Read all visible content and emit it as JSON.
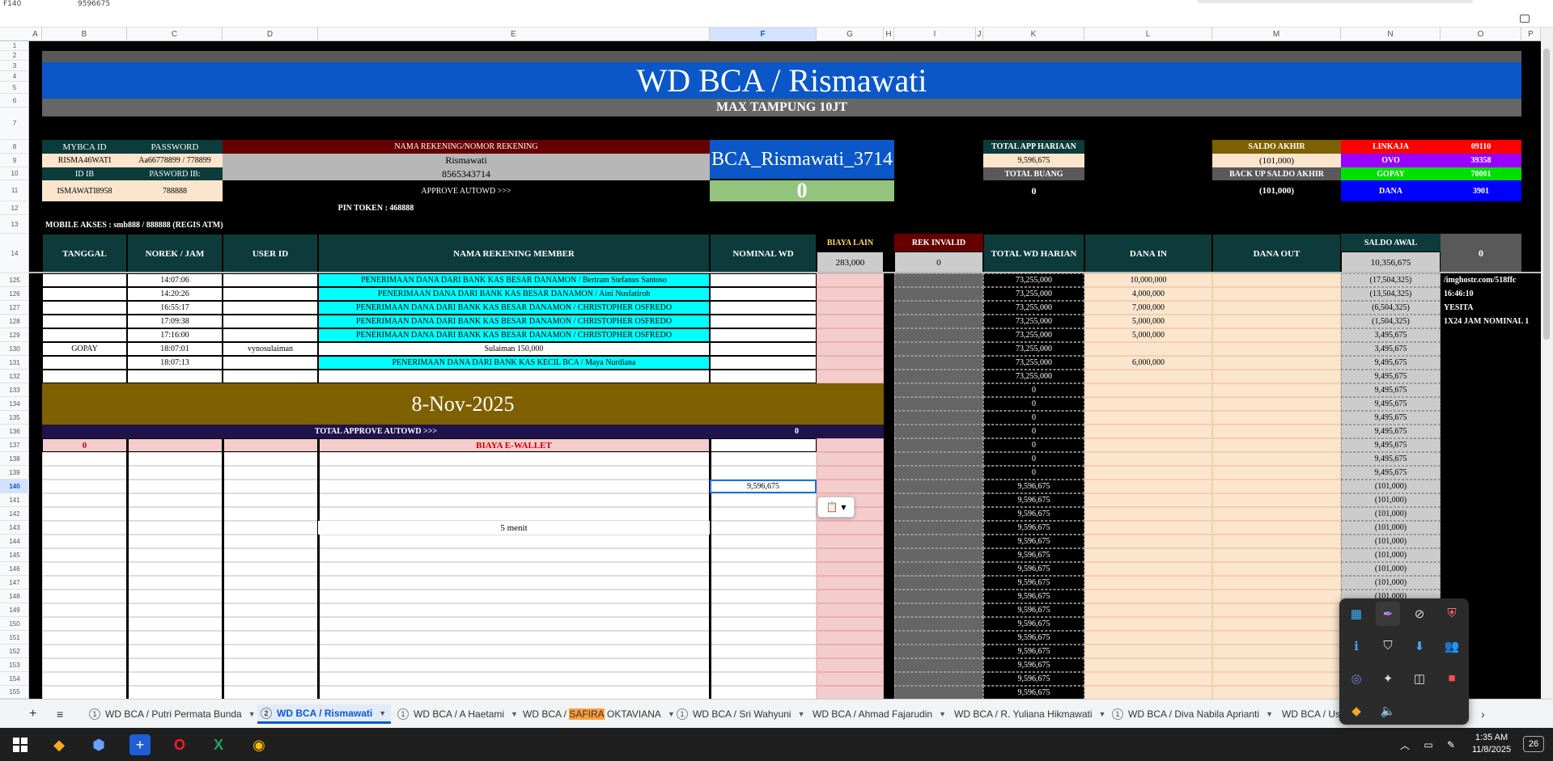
{
  "top": {
    "cell_ref": "F140",
    "formula_value": "9596675"
  },
  "columns": [
    "A",
    "B",
    "C",
    "D",
    "E",
    "F",
    "G",
    "H",
    "I",
    "J",
    "K",
    "L",
    "M",
    "N",
    "O",
    "P"
  ],
  "rows": [
    "1",
    "2",
    "3",
    "4",
    "5",
    "6",
    "7",
    "8",
    "9",
    "10",
    "11",
    "12",
    "13",
    "14",
    "125",
    "126",
    "127",
    "128",
    "129",
    "130",
    "131",
    "132",
    "133",
    "134",
    "135",
    "136",
    "137",
    "138",
    "139",
    "140",
    "141",
    "142",
    "143",
    "144",
    "145",
    "146",
    "147",
    "148",
    "149",
    "150",
    "151",
    "152",
    "153",
    "154",
    "155"
  ],
  "sheet": {
    "title": "WD BCA / Rismawati",
    "subtitle": "MAX TAMPUNG 10JT",
    "h_mybca": "MYBCA ID",
    "h_password": "PASSWORD",
    "h_nama": "NAMA REKENING/NOMOR REKENING",
    "mybca_id": "RISMA46WATI",
    "password": "Aa66778899 / 778899",
    "rek_name": "Rismawati",
    "rek_no": "8565343714",
    "h_idib": "ID IB",
    "h_pasib": "PASWORD IB:",
    "idib": "ISMAWATI8958",
    "pasib": "788888",
    "approve_autowd": "APPROVE AUTOWD >>>",
    "account_label": "BCA_Rismawati_3714",
    "autowd_value": "0",
    "pin_token": "PIN TOKEN : 468888",
    "mobile_akses": "MOBILE AKSES : smb888 / 888888 (REGIS ATM)",
    "h_total_app": "TOTAL APP HARIAAN",
    "total_app": "9,596,675",
    "h_total_buang": "TOTAL BUANG",
    "total_buang": "0",
    "h_saldo_akhir": "SALDO AKHIR",
    "saldo_akhir": "(101,000)",
    "h_backup": "BACK UP SALDO AKHIR",
    "backup": "(101,000)",
    "ewallets": [
      {
        "name": "LINKAJA",
        "value": "09110",
        "color": "#ff0000"
      },
      {
        "name": "OVO",
        "value": "39358",
        "color": "#9900ff"
      },
      {
        "name": "GOPAY",
        "value": "70001",
        "color": "#00e000"
      },
      {
        "name": "DANA",
        "value": "3901",
        "color": "#0000ff"
      }
    ],
    "hdr": {
      "tanggal": "TANGGAL",
      "norek": "NOREK / JAM",
      "user": "USER ID",
      "nama_member": "NAMA REKENING MEMBER",
      "nominal": "NOMINAL WD",
      "biaya": "BIAYA LAIN",
      "biaya_val": "283,000",
      "rek_invalid": "REK INVALID",
      "rek_invalid_val": "0",
      "total_wd": "TOTAL WD HARIAN",
      "dana_in": "DANA IN",
      "dana_out": "DANA OUT",
      "saldo_awal": "SALDO AWAL",
      "saldo_awal_val": "10,356,675",
      "o_val": "0"
    },
    "date_banner": "8-Nov-2025",
    "total_approve": "TOTAL APPROVE AUTOWD >>>",
    "total_approve_val": "0",
    "biaya_ewallet_val": "0",
    "biaya_ewallet": "BIAYA E-WALLET",
    "lima_menit": "5 menit",
    "o_notes": [
      "/imghostr.com/518ffc",
      "16:46:10",
      "YESITA",
      "1X24 JAM NOMINAL 1"
    ],
    "data_rows": [
      {
        "tanggal": "",
        "jam": "14:07:06",
        "user": "",
        "nama": "PENERIMAAN DANA DARI BANK KAS BESAR DANAMON / Bertram Stefanus Santoso",
        "nominal": "",
        "total": "73,255,000",
        "dana_in": "10,000,000",
        "saldo": "(17,504,325)"
      },
      {
        "tanggal": "",
        "jam": "14:20:26",
        "user": "",
        "nama": "PENERIMAAN DANA DARI BANK KAS BESAR DANAMON / Aini Nusfatiroh",
        "nominal": "",
        "total": "73,255,000",
        "dana_in": "4,000,000",
        "saldo": "(13,504,325)"
      },
      {
        "tanggal": "",
        "jam": "16:55:17",
        "user": "",
        "nama": "PENERIMAAN DANA DARI BANK KAS BESAR DANAMON / CHRISTOPHER OSFREDO",
        "nominal": "",
        "total": "73,255,000",
        "dana_in": "7,000,000",
        "saldo": "(6,504,325)"
      },
      {
        "tanggal": "",
        "jam": "17:09:38",
        "user": "",
        "nama": "PENERIMAAN DANA DARI BANK KAS BESAR DANAMON / CHRISTOPHER OSFREDO",
        "nominal": "",
        "total": "73,255,000",
        "dana_in": "5,000,000",
        "saldo": "(1,504,325)"
      },
      {
        "tanggal": "",
        "jam": "17:16:00",
        "user": "",
        "nama": "PENERIMAAN DANA DARI BANK KAS BESAR DANAMON / CHRISTOPHER OSFREDO",
        "nominal": "",
        "total": "73,255,000",
        "dana_in": "5,000,000",
        "saldo": "3,495,675"
      },
      {
        "tanggal": "GOPAY",
        "jam": "18:07:01",
        "user": "vynosulaiman",
        "nama": "Sulaiman 150,000",
        "nominal": "",
        "total": "73,255,000",
        "dana_in": "",
        "saldo": "3,495,675"
      },
      {
        "tanggal": "",
        "jam": "18:07:13",
        "user": "",
        "nama": "PENERIMAAN DANA DARI BANK KAS KECIL BCA / Maya Nurdiana",
        "nominal": "",
        "total": "73,255,000",
        "dana_in": "6,000,000",
        "saldo": "9,495,675"
      },
      {
        "tanggal": "",
        "jam": "",
        "user": "",
        "nama": "",
        "nominal": "",
        "total": "73,255,000",
        "dana_in": "",
        "saldo": "9,495,675"
      }
    ],
    "lower_totals": [
      "0",
      "0",
      "0",
      "0",
      "0",
      "0",
      "0",
      "9,596,675",
      "9,596,675",
      "9,596,675",
      "9,596,675",
      "9,596,675",
      "9,596,675",
      "9,596,675",
      "9,596,675",
      "9,596,675",
      "9,596,675",
      "9,596,675",
      "9,596,675",
      "9,596,675",
      "9,596,675",
      "9,596,675",
      "9,596,675"
    ],
    "lower_saldo": [
      "9,495,675",
      "9,495,675",
      "9,495,675",
      "9,495,675",
      "9,495,675",
      "9,495,675",
      "9,495,675",
      "(101,000)",
      "(101,000)",
      "(101,000)",
      "(101,000)",
      "(101,000)",
      "(101,000)",
      "(101,000)",
      "(101,000)",
      "(101,000)",
      "(101,000)"
    ],
    "nominal_140": "9,596,675"
  },
  "tabs": [
    {
      "num": "1",
      "label": "WD BCA / Putri Permata Bunda"
    },
    {
      "num": "2",
      "label": "WD BCA / Rismawati",
      "active": true
    },
    {
      "num": "1",
      "label": "WD BCA / A Haetami"
    },
    {
      "num": "",
      "label_pre": "WD BCA / ",
      "label_hl": "SAFIRA",
      "label_post": " OKTAVIANA"
    },
    {
      "num": "1",
      "label": "WD BCA / Sri Wahyuni"
    },
    {
      "num": "",
      "label": "WD BCA / Ahmad Fajarudin"
    },
    {
      "num": "",
      "label": "WD BCA / R. Yuliana Hikmawati"
    },
    {
      "num": "1",
      "label": "WD BCA / Diva Nabila Aprianti"
    },
    {
      "num": "",
      "label": "WD BCA / Usw"
    }
  ],
  "taskbar": {
    "time": "1:35 AM",
    "date": "11/8/2025",
    "badge": "26"
  }
}
